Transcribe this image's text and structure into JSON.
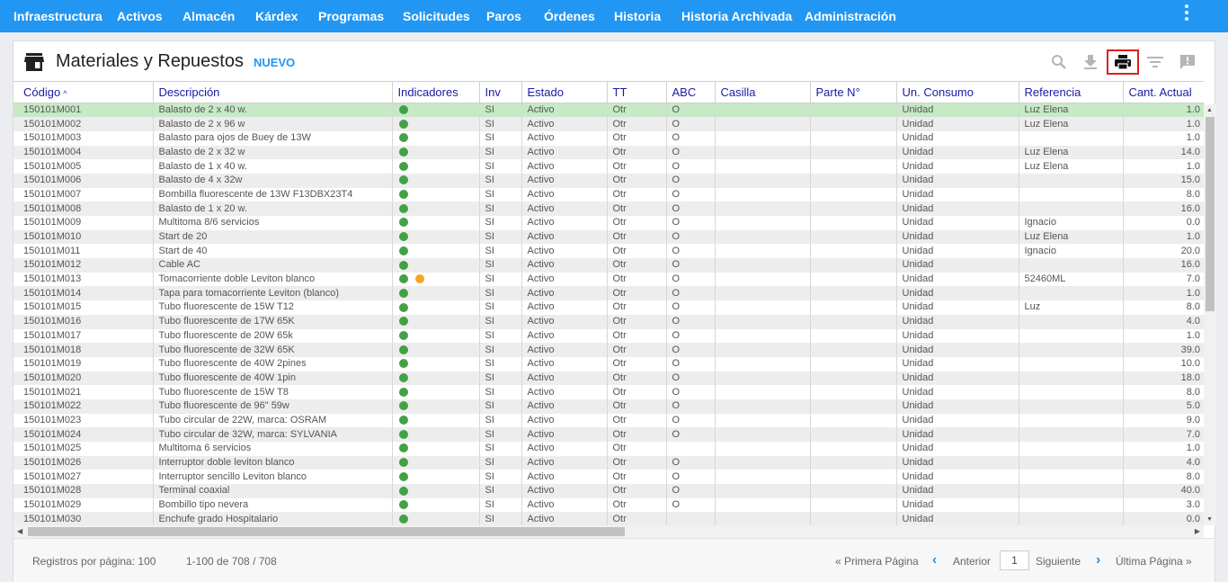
{
  "nav": {
    "items": [
      "Infraestructura",
      "Activos",
      "Almacén",
      "Kárdex",
      "Programas",
      "Solicitudes",
      "Paros",
      "Órdenes",
      "Historia",
      "Historia Archivada",
      "Administración"
    ]
  },
  "header": {
    "title": "Materiales y Repuestos",
    "new_label": "NUEVO",
    "tools": [
      "search-icon",
      "download-icon",
      "print-icon",
      "filter-icon",
      "feedback-icon"
    ]
  },
  "table": {
    "columns": [
      "Código",
      "Descripción",
      "Indicadores",
      "Inv",
      "Estado",
      "TT",
      "ABC",
      "Casilla",
      "Parte N°",
      "Un. Consumo",
      "Referencia",
      "Cant. Actual"
    ],
    "sort_indicator": "^",
    "status_colors": {
      "green": "#43a047",
      "orange": "#f5a623",
      "selected_row": "#c7e9c5"
    },
    "rows": [
      {
        "code": "150101M001",
        "desc": "Balasto de 2 x 40 w.",
        "ind": [
          "green"
        ],
        "inv": "SI",
        "estado": "Activo",
        "tt": "Otr",
        "abc": "O",
        "casilla": "",
        "parte": "",
        "un": "Unidad",
        "ref": "Luz Elena",
        "cant": "1.0"
      },
      {
        "code": "150101M002",
        "desc": "Balasto de 2 x 96 w",
        "ind": [
          "green"
        ],
        "inv": "SI",
        "estado": "Activo",
        "tt": "Otr",
        "abc": "O",
        "casilla": "",
        "parte": "",
        "un": "Unidad",
        "ref": "Luz Elena",
        "cant": "1.0"
      },
      {
        "code": "150101M003",
        "desc": "Balasto para ojos de Buey de 13W",
        "ind": [
          "green"
        ],
        "inv": "SI",
        "estado": "Activo",
        "tt": "Otr",
        "abc": "O",
        "casilla": "",
        "parte": "",
        "un": "Unidad",
        "ref": "",
        "cant": "1.0"
      },
      {
        "code": "150101M004",
        "desc": "Balasto de 2 x 32 w",
        "ind": [
          "green"
        ],
        "inv": "SI",
        "estado": "Activo",
        "tt": "Otr",
        "abc": "O",
        "casilla": "",
        "parte": "",
        "un": "Unidad",
        "ref": "Luz Elena",
        "cant": "14.0"
      },
      {
        "code": "150101M005",
        "desc": "Balasto de 1 x 40 w.",
        "ind": [
          "green"
        ],
        "inv": "SI",
        "estado": "Activo",
        "tt": "Otr",
        "abc": "O",
        "casilla": "",
        "parte": "",
        "un": "Unidad",
        "ref": "Luz Elena",
        "cant": "1.0"
      },
      {
        "code": "150101M006",
        "desc": "Balasto de 4 x 32w",
        "ind": [
          "green"
        ],
        "inv": "SI",
        "estado": "Activo",
        "tt": "Otr",
        "abc": "O",
        "casilla": "",
        "parte": "",
        "un": "Unidad",
        "ref": "",
        "cant": "15.0"
      },
      {
        "code": "150101M007",
        "desc": "Bombilla fluorescente de 13W F13DBX23T4",
        "ind": [
          "green"
        ],
        "inv": "SI",
        "estado": "Activo",
        "tt": "Otr",
        "abc": "O",
        "casilla": "",
        "parte": "",
        "un": "Unidad",
        "ref": "",
        "cant": "8.0"
      },
      {
        "code": "150101M008",
        "desc": "Balasto de 1 x 20 w.",
        "ind": [
          "green"
        ],
        "inv": "SI",
        "estado": "Activo",
        "tt": "Otr",
        "abc": "O",
        "casilla": "",
        "parte": "",
        "un": "Unidad",
        "ref": "",
        "cant": "16.0"
      },
      {
        "code": "150101M009",
        "desc": "Multitoma 8/6 servicios",
        "ind": [
          "green"
        ],
        "inv": "SI",
        "estado": "Activo",
        "tt": "Otr",
        "abc": "O",
        "casilla": "",
        "parte": "",
        "un": "Unidad",
        "ref": "Ignacio",
        "cant": "0.0"
      },
      {
        "code": "150101M010",
        "desc": "Start de 20",
        "ind": [
          "green"
        ],
        "inv": "SI",
        "estado": "Activo",
        "tt": "Otr",
        "abc": "O",
        "casilla": "",
        "parte": "",
        "un": "Unidad",
        "ref": "Luz Elena",
        "cant": "1.0"
      },
      {
        "code": "150101M011",
        "desc": "Start de 40",
        "ind": [
          "green"
        ],
        "inv": "SI",
        "estado": "Activo",
        "tt": "Otr",
        "abc": "O",
        "casilla": "",
        "parte": "",
        "un": "Unidad",
        "ref": "Ignacio",
        "cant": "20.0"
      },
      {
        "code": "150101M012",
        "desc": "Cable AC",
        "ind": [
          "green"
        ],
        "inv": "SI",
        "estado": "Activo",
        "tt": "Otr",
        "abc": "O",
        "casilla": "",
        "parte": "",
        "un": "Unidad",
        "ref": "",
        "cant": "16.0"
      },
      {
        "code": "150101M013",
        "desc": "Tomacorriente doble Leviton blanco",
        "ind": [
          "green",
          "orange"
        ],
        "inv": "SI",
        "estado": "Activo",
        "tt": "Otr",
        "abc": "O",
        "casilla": "",
        "parte": "",
        "un": "Unidad",
        "ref": "52460ML",
        "cant": "7.0"
      },
      {
        "code": "150101M014",
        "desc": "Tapa para tomacorriente Leviton (blanco)",
        "ind": [
          "green"
        ],
        "inv": "SI",
        "estado": "Activo",
        "tt": "Otr",
        "abc": "O",
        "casilla": "",
        "parte": "",
        "un": "Unidad",
        "ref": "",
        "cant": "1.0"
      },
      {
        "code": "150101M015",
        "desc": "Tubo fluorescente de 15W T12",
        "ind": [
          "green"
        ],
        "inv": "SI",
        "estado": "Activo",
        "tt": "Otr",
        "abc": "O",
        "casilla": "",
        "parte": "",
        "un": "Unidad",
        "ref": "Luz",
        "cant": "8.0"
      },
      {
        "code": "150101M016",
        "desc": "Tubo fluorescente de 17W 65K",
        "ind": [
          "green"
        ],
        "inv": "SI",
        "estado": "Activo",
        "tt": "Otr",
        "abc": "O",
        "casilla": "",
        "parte": "",
        "un": "Unidad",
        "ref": "",
        "cant": "4.0"
      },
      {
        "code": "150101M017",
        "desc": "Tubo fluorescente de 20W 65k",
        "ind": [
          "green"
        ],
        "inv": "SI",
        "estado": "Activo",
        "tt": "Otr",
        "abc": "O",
        "casilla": "",
        "parte": "",
        "un": "Unidad",
        "ref": "",
        "cant": "1.0"
      },
      {
        "code": "150101M018",
        "desc": "Tubo fluorescente de 32W 65K",
        "ind": [
          "green"
        ],
        "inv": "SI",
        "estado": "Activo",
        "tt": "Otr",
        "abc": "O",
        "casilla": "",
        "parte": "",
        "un": "Unidad",
        "ref": "",
        "cant": "39.0"
      },
      {
        "code": "150101M019",
        "desc": "Tubo fluorescente de 40W 2pines",
        "ind": [
          "green"
        ],
        "inv": "SI",
        "estado": "Activo",
        "tt": "Otr",
        "abc": "O",
        "casilla": "",
        "parte": "",
        "un": "Unidad",
        "ref": "",
        "cant": "10.0"
      },
      {
        "code": "150101M020",
        "desc": "Tubo fluorescente de 40W 1pin",
        "ind": [
          "green"
        ],
        "inv": "SI",
        "estado": "Activo",
        "tt": "Otr",
        "abc": "O",
        "casilla": "",
        "parte": "",
        "un": "Unidad",
        "ref": "",
        "cant": "18.0"
      },
      {
        "code": "150101M021",
        "desc": "Tubo fluorescente de 15W T8",
        "ind": [
          "green"
        ],
        "inv": "SI",
        "estado": "Activo",
        "tt": "Otr",
        "abc": "O",
        "casilla": "",
        "parte": "",
        "un": "Unidad",
        "ref": "",
        "cant": "8.0"
      },
      {
        "code": "150101M022",
        "desc": "Tubo fluorescente de 96\" 59w",
        "ind": [
          "green"
        ],
        "inv": "SI",
        "estado": "Activo",
        "tt": "Otr",
        "abc": "O",
        "casilla": "",
        "parte": "",
        "un": "Unidad",
        "ref": "",
        "cant": "5.0"
      },
      {
        "code": "150101M023",
        "desc": "Tubo circular de 22W, marca: OSRAM",
        "ind": [
          "green"
        ],
        "inv": "SI",
        "estado": "Activo",
        "tt": "Otr",
        "abc": "O",
        "casilla": "",
        "parte": "",
        "un": "Unidad",
        "ref": "",
        "cant": "9.0"
      },
      {
        "code": "150101M024",
        "desc": "Tubo circular de 32W, marca: SYLVANIA",
        "ind": [
          "green"
        ],
        "inv": "SI",
        "estado": "Activo",
        "tt": "Otr",
        "abc": "O",
        "casilla": "",
        "parte": "",
        "un": "Unidad",
        "ref": "",
        "cant": "7.0"
      },
      {
        "code": "150101M025",
        "desc": "Multitoma 6 servicios",
        "ind": [
          "green"
        ],
        "inv": "SI",
        "estado": "Activo",
        "tt": "Otr",
        "abc": "",
        "casilla": "",
        "parte": "",
        "un": "Unidad",
        "ref": "",
        "cant": "1.0"
      },
      {
        "code": "150101M026",
        "desc": "Interruptor doble leviton blanco",
        "ind": [
          "green"
        ],
        "inv": "SI",
        "estado": "Activo",
        "tt": "Otr",
        "abc": "O",
        "casilla": "",
        "parte": "",
        "un": "Unidad",
        "ref": "",
        "cant": "4.0"
      },
      {
        "code": "150101M027",
        "desc": "Interruptor sencillo Leviton blanco",
        "ind": [
          "green"
        ],
        "inv": "SI",
        "estado": "Activo",
        "tt": "Otr",
        "abc": "O",
        "casilla": "",
        "parte": "",
        "un": "Unidad",
        "ref": "",
        "cant": "8.0"
      },
      {
        "code": "150101M028",
        "desc": "Terminal coaxial",
        "ind": [
          "green"
        ],
        "inv": "SI",
        "estado": "Activo",
        "tt": "Otr",
        "abc": "O",
        "casilla": "",
        "parte": "",
        "un": "Unidad",
        "ref": "",
        "cant": "40.0"
      },
      {
        "code": "150101M029",
        "desc": "Bombillo tipo nevera",
        "ind": [
          "green"
        ],
        "inv": "SI",
        "estado": "Activo",
        "tt": "Otr",
        "abc": "O",
        "casilla": "",
        "parte": "",
        "un": "Unidad",
        "ref": "",
        "cant": "3.0"
      },
      {
        "code": "150101M030",
        "desc": "Enchufe grado Hospitalario",
        "ind": [
          "green"
        ],
        "inv": "SI",
        "estado": "Activo",
        "tt": "Otr",
        "abc": "",
        "casilla": "",
        "parte": "",
        "un": "Unidad",
        "ref": "",
        "cant": "0.0"
      }
    ]
  },
  "footer": {
    "per_page": "Registros por página: 100",
    "range": "1-100 de 708 / 708",
    "first": "« Primera Página",
    "prev": "Anterior",
    "page": "1",
    "next": "Siguiente",
    "last": "Última Página »"
  }
}
